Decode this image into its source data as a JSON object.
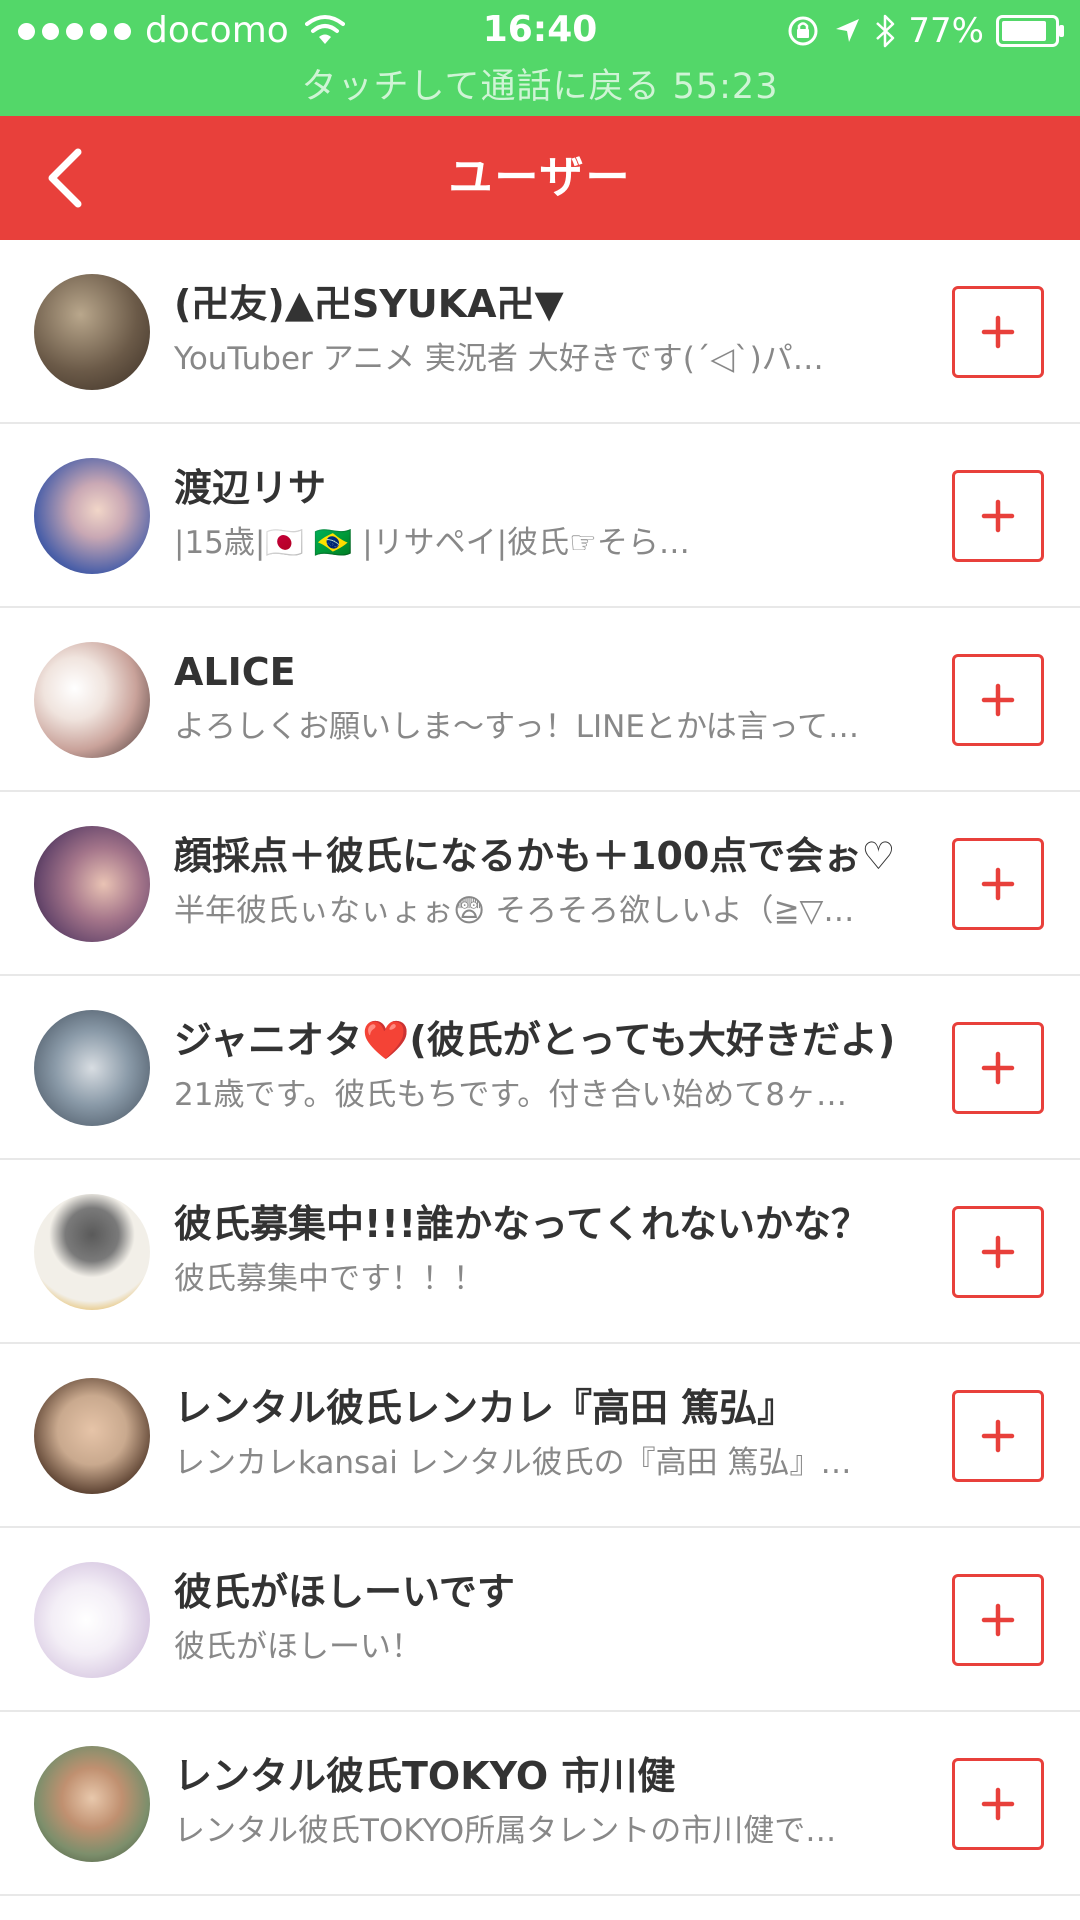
{
  "status": {
    "carrier": "docomo",
    "time": "16:40",
    "battery": "77%",
    "call_banner": "タッチして通話に戻る 55:23"
  },
  "header": {
    "title": "ユーザー"
  },
  "users": [
    {
      "name": "(卍友)▲卍SYUKA卍▼",
      "description": "YouTuber アニメ 実況者 大好きです(ˊ◁ˋ)パ…",
      "avatar_color": "#6b5a48"
    },
    {
      "name": "渡辺リサ",
      "description": "|15歳|🇯🇵 🇧🇷 |リサペイ|彼氏☞そら…",
      "avatar_color": "#4a5fa8"
    },
    {
      "name": "ALICE",
      "description": "よろしくお願いしま〜すっ！LINEとかは言って…",
      "avatar_color": "#d9c3b8"
    },
    {
      "name": "顔採点＋彼氏になるかも＋100点で会ぉ♡",
      "description": "半年彼氏ぃなぃょぉ😨 そろそろ欲しいよ（≧▽…",
      "avatar_color": "#6b4a6e"
    },
    {
      "name": "ジャニオタ❤️(彼氏がとっても大好きだよ)",
      "description": "21歳です。彼氏もちです。付き合い始めて8ヶ…",
      "avatar_color": "#8a9aa8"
    },
    {
      "name": "彼氏募集中!!!誰かなってくれないかな？",
      "description": "彼氏募集中です！！！",
      "avatar_color": "#f2efe8"
    },
    {
      "name": "レンタル彼氏レンカレ『高田 篤弘』",
      "description": "レンカレkansai レンタル彼氏の『高田 篤弘』…",
      "avatar_color": "#c9a98e"
    },
    {
      "name": "彼氏がほしーいです",
      "description": "彼氏がほしーい！",
      "avatar_color": "#e9e2f0"
    },
    {
      "name": "レンタル彼氏TOKYO 市川健",
      "description": "レンタル彼氏TOKYO所属タレントの市川健で…",
      "avatar_color": "#7d8f6c"
    }
  ],
  "colors": {
    "status_green": "#53d769",
    "nav_red": "#e8403b",
    "accent": "#e8403b"
  }
}
